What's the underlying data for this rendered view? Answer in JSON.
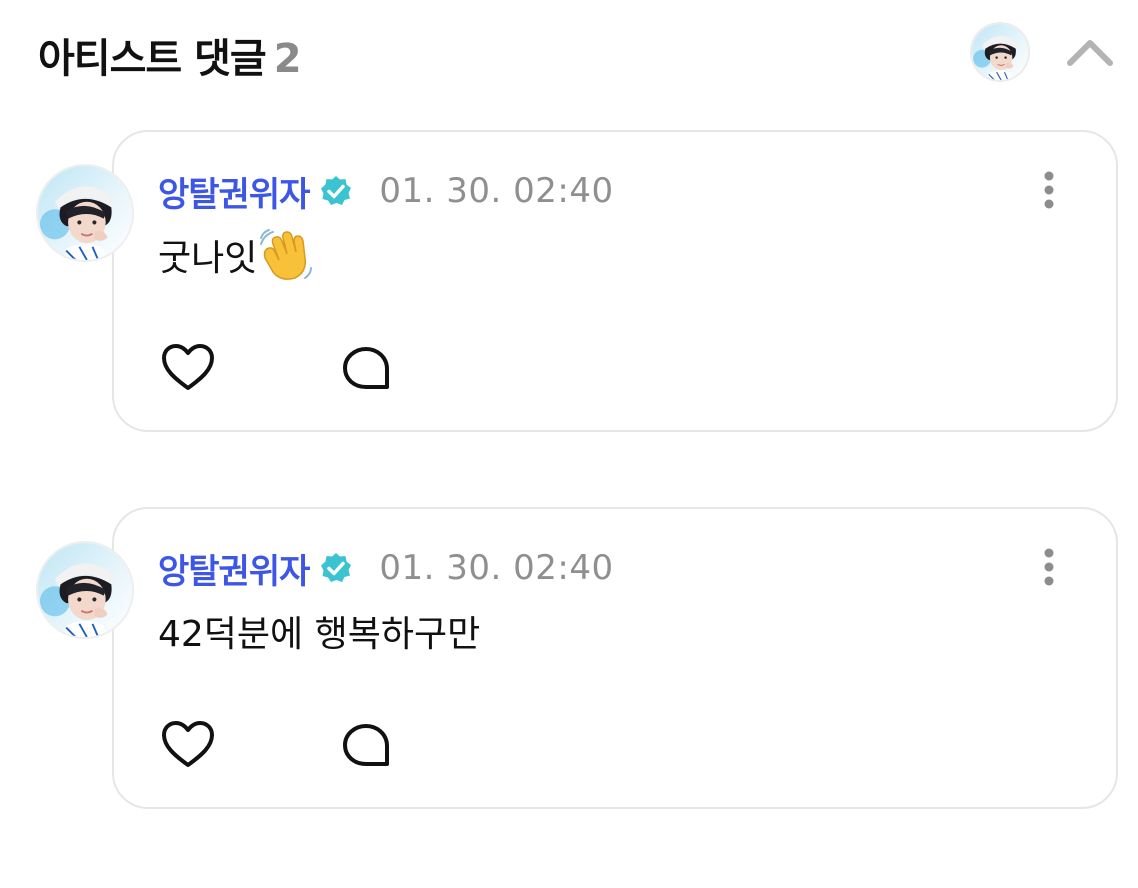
{
  "header": {
    "title": "아티스트 댓글",
    "count": "2",
    "avatar_icon": "artist-avatar",
    "collapse_icon": "chevron-up-icon"
  },
  "comments": [
    {
      "author": "앙탈권위자",
      "verified_icon": "verified-badge-icon",
      "timestamp": "01. 30. 02:40",
      "text": "굿나잇",
      "emoji": "waving-hand",
      "more_icon": "more-vertical-icon",
      "like_icon": "heart-icon",
      "reply_icon": "comment-bubble-icon"
    },
    {
      "author": "앙탈권위자",
      "verified_icon": "verified-badge-icon",
      "timestamp": "01. 30. 02:40",
      "text": "42덕분에 행복하구만",
      "more_icon": "more-vertical-icon",
      "like_icon": "heart-icon",
      "reply_icon": "comment-bubble-icon"
    }
  ],
  "colors": {
    "author": "#3d56e6",
    "verified": "#3cc3d2",
    "timestamp": "#8f8f8f",
    "count": "#8a8a8a",
    "card_border": "#e6e6e6"
  }
}
